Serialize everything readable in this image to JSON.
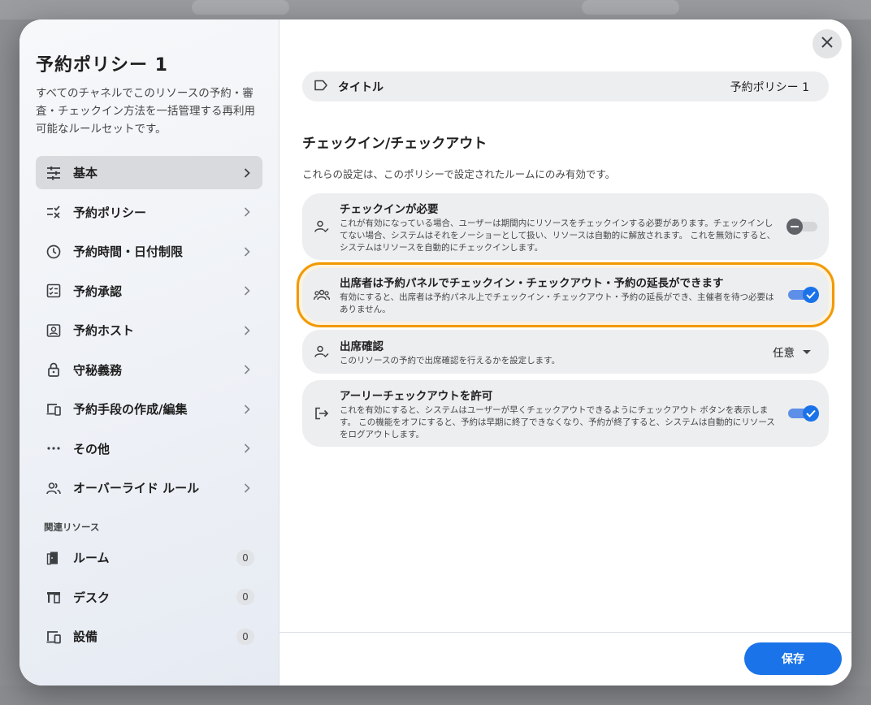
{
  "sidebar": {
    "title": "予約ポリシー 1",
    "description": "すべてのチャネルでこのリソースの予約・審査・チェックイン方法を一括管理する再利用可能なルールセットです。",
    "items": [
      {
        "label": "基本",
        "icon": "tune-icon"
      },
      {
        "label": "予約ポリシー",
        "icon": "checklist-icon"
      },
      {
        "label": "予約時間・日付制限",
        "icon": "clock-icon"
      },
      {
        "label": "予約承認",
        "icon": "approval-icon"
      },
      {
        "label": "予約ホスト",
        "icon": "host-icon"
      },
      {
        "label": "守秘義務",
        "icon": "lock-icon"
      },
      {
        "label": "予約手段の作成/編集",
        "icon": "devices-icon"
      },
      {
        "label": "その他",
        "icon": "more-icon"
      },
      {
        "label": "オーバーライド ルール",
        "icon": "people-icon"
      }
    ],
    "related_heading": "関連リソース",
    "related": [
      {
        "label": "ルーム",
        "count": "0",
        "icon": "door-icon"
      },
      {
        "label": "デスク",
        "count": "0",
        "icon": "desk-icon"
      },
      {
        "label": "設備",
        "count": "0",
        "icon": "equipment-icon"
      }
    ]
  },
  "main": {
    "title_field": {
      "label": "タイトル",
      "value": "予約ポリシー 1"
    },
    "section_heading": "チェックイン/チェックアウト",
    "section_note": "これらの設定は、このポリシーで設定されたルームにのみ有効です。",
    "cards": [
      {
        "title": "チェックインが必要",
        "desc": "これが有効になっている場合、ユーザーは期間内にリソースをチェックインする必要があります。チェックインしてない場合、システムはそれをノーショーとして扱い、リソースは自動的に解放されます。 これを無効にすると、システムはリソースを自動的にチェックインします。",
        "state": "off"
      },
      {
        "title": "出席者は予約パネルでチェックイン・チェックアウト・予約の延長ができます",
        "desc": "有効にすると、出席者は予約パネル上でチェックイン・チェックアウト・予約の延長ができ、主催者を待つ必要はありません。",
        "state": "on"
      },
      {
        "title": "出席確認",
        "desc": "このリソースの予約で出席確認を行えるかを設定します。",
        "select_value": "任意"
      },
      {
        "title": "アーリーチェックアウトを許可",
        "desc": "これを有効にすると、システムはユーザーが早くチェックアウトできるようにチェックアウト ボタンを表示します。 この機能をオフにすると、予約は早期に終了できなくなり、予約が終了すると、システムは自動的にリソースをログアウトします。",
        "state": "on"
      }
    ],
    "save_label": "保存"
  },
  "colors": {
    "accent": "#1a73e8",
    "highlight": "#f29900"
  }
}
